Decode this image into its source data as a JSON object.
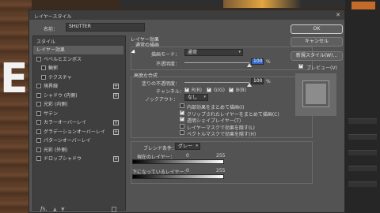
{
  "background": {
    "letters": "E"
  },
  "dialog": {
    "title": "レイヤースタイル",
    "close_icon": "close-icon"
  },
  "name_field": {
    "label": "名前：",
    "value": "SHUTTER"
  },
  "style_list": {
    "header": "スタイル",
    "items": [
      {
        "label": "レイヤー効果",
        "has_checkbox": false,
        "has_plus": false,
        "selected": true
      },
      {
        "label": "ベベルとエンボス",
        "has_checkbox": true,
        "has_plus": false,
        "selected": false
      },
      {
        "label": "輪郭",
        "has_checkbox": true,
        "has_plus": false,
        "selected": false,
        "indent": true
      },
      {
        "label": "テクスチャ",
        "has_checkbox": true,
        "has_plus": false,
        "selected": false,
        "indent": true
      },
      {
        "label": "境界線",
        "has_checkbox": true,
        "has_plus": true,
        "selected": false
      },
      {
        "label": "シャドウ (内側)",
        "has_checkbox": true,
        "has_plus": true,
        "selected": false
      },
      {
        "label": "光彩 (内側)",
        "has_checkbox": true,
        "has_plus": false,
        "selected": false
      },
      {
        "label": "サテン",
        "has_checkbox": true,
        "has_plus": false,
        "selected": false
      },
      {
        "label": "カラーオーバーレイ",
        "has_checkbox": true,
        "has_plus": true,
        "selected": false
      },
      {
        "label": "グラデーションオーバーレイ",
        "has_checkbox": true,
        "has_plus": true,
        "selected": false
      },
      {
        "label": "パターンオーバーレイ",
        "has_checkbox": true,
        "has_plus": false,
        "selected": false
      },
      {
        "label": "光彩 (外側)",
        "has_checkbox": true,
        "has_plus": false,
        "selected": false
      },
      {
        "label": "ドロップシャドウ",
        "has_checkbox": true,
        "has_plus": true,
        "selected": false
      }
    ],
    "footer_fx": "fx."
  },
  "layer_effects": {
    "title": "レイヤー効果",
    "subtitle": "通常の描画",
    "blend_mode_label": "描画モード：",
    "blend_mode_value": "通常",
    "opacity_label": "不透明度：",
    "opacity_value": "100",
    "opacity_unit": "%",
    "opacity_level": 1.0
  },
  "advanced": {
    "title": "高度な合成",
    "fill_opacity_label": "塗りの不透明度：",
    "fill_opacity_value": "100",
    "fill_opacity_unit": "%",
    "fill_opacity_level": 1.0,
    "channels_label": "チャンネル：",
    "channels": [
      {
        "label": "R(R)",
        "checked": true
      },
      {
        "label": "G(G)",
        "checked": true
      },
      {
        "label": "B(B)",
        "checked": true
      }
    ],
    "knockout_label": "ノックアウト：",
    "knockout_value": "なし",
    "options": [
      {
        "label": "内部効果をまとめて描画(I)",
        "checked": false
      },
      {
        "label": "クリップされたレイヤーをまとめて描画(C)",
        "checked": true
      },
      {
        "label": "透明シェイプレイヤー(T)",
        "checked": true
      },
      {
        "label": "レイヤーマスクで効果を隠す(L)",
        "checked": false
      },
      {
        "label": "ベクトルマスクで効果を隠す(H)",
        "checked": false
      }
    ]
  },
  "blend_if": {
    "label": "ブレンド条件：",
    "value": "グレー",
    "this_layer_label": "現在のレイヤー：",
    "this_layer_min": "0",
    "this_layer_max": "255",
    "underlying_label": "下になっているレイヤー：",
    "underlying_min": "0",
    "underlying_max": "255"
  },
  "buttons": {
    "ok": "OK",
    "cancel": "キャンセル",
    "new_style": "新規スタイル(W)...",
    "preview_label": "プレビュー(V)",
    "preview_checked": true
  }
}
